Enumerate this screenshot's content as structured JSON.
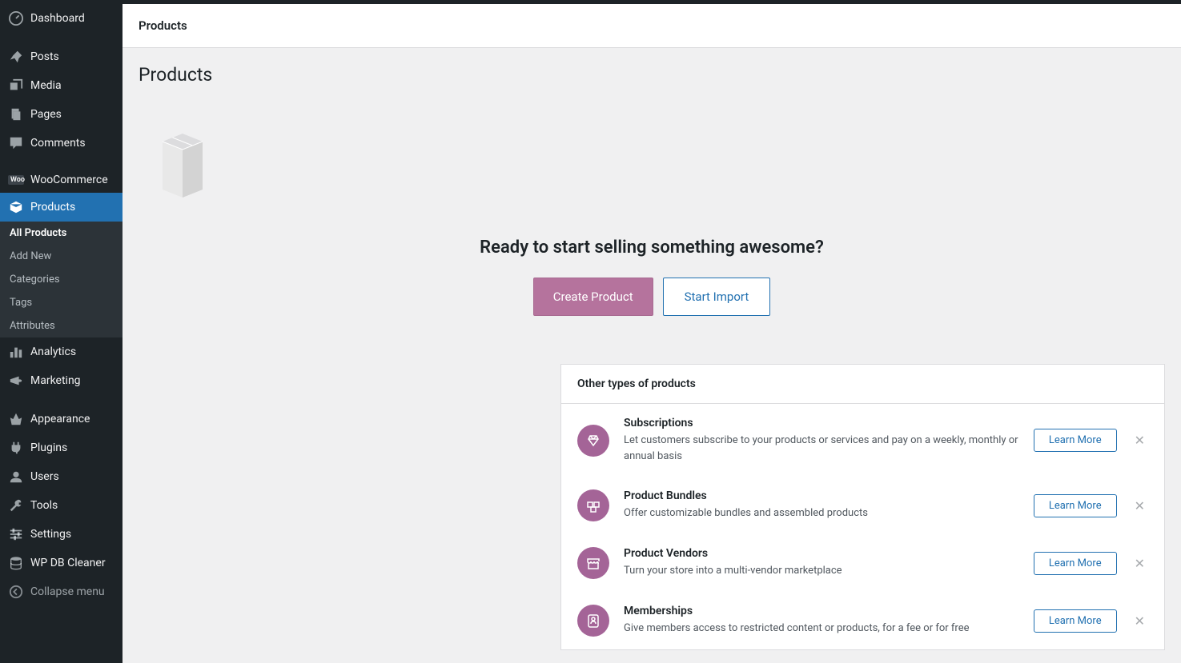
{
  "topnav": {
    "title": "Products"
  },
  "sidebar": {
    "items": [
      {
        "label": "Dashboard",
        "icon": "dashboard"
      },
      {
        "label": "Posts",
        "icon": "pin"
      },
      {
        "label": "Media",
        "icon": "media"
      },
      {
        "label": "Pages",
        "icon": "pages"
      },
      {
        "label": "Comments",
        "icon": "comments"
      },
      {
        "label": "WooCommerce",
        "icon": "woo"
      },
      {
        "label": "Products",
        "icon": "products",
        "active": true
      },
      {
        "label": "Analytics",
        "icon": "analytics"
      },
      {
        "label": "Marketing",
        "icon": "marketing"
      },
      {
        "label": "Appearance",
        "icon": "appearance"
      },
      {
        "label": "Plugins",
        "icon": "plugins"
      },
      {
        "label": "Users",
        "icon": "users"
      },
      {
        "label": "Tools",
        "icon": "tools"
      },
      {
        "label": "Settings",
        "icon": "settings"
      },
      {
        "label": "WP DB Cleaner",
        "icon": "db"
      },
      {
        "label": "Collapse menu",
        "icon": "collapse"
      }
    ],
    "submenu": [
      {
        "label": "All Products",
        "active": true
      },
      {
        "label": "Add New"
      },
      {
        "label": "Categories"
      },
      {
        "label": "Tags"
      },
      {
        "label": "Attributes"
      }
    ]
  },
  "main": {
    "page_title": "Products",
    "hero": {
      "headline": "Ready to start selling something awesome?",
      "create_label": "Create Product",
      "import_label": "Start Import"
    },
    "other": {
      "heading": "Other types of products",
      "learn_more": "Learn More",
      "items": [
        {
          "title": "Subscriptions",
          "desc": "Let customers subscribe to your products or services and pay on a weekly, monthly or annual basis"
        },
        {
          "title": "Product Bundles",
          "desc": "Offer customizable bundles and assembled products"
        },
        {
          "title": "Product Vendors",
          "desc": "Turn your store into a multi-vendor marketplace"
        },
        {
          "title": "Memberships",
          "desc": "Give members access to restricted content or products, for a fee or for free"
        }
      ]
    }
  }
}
